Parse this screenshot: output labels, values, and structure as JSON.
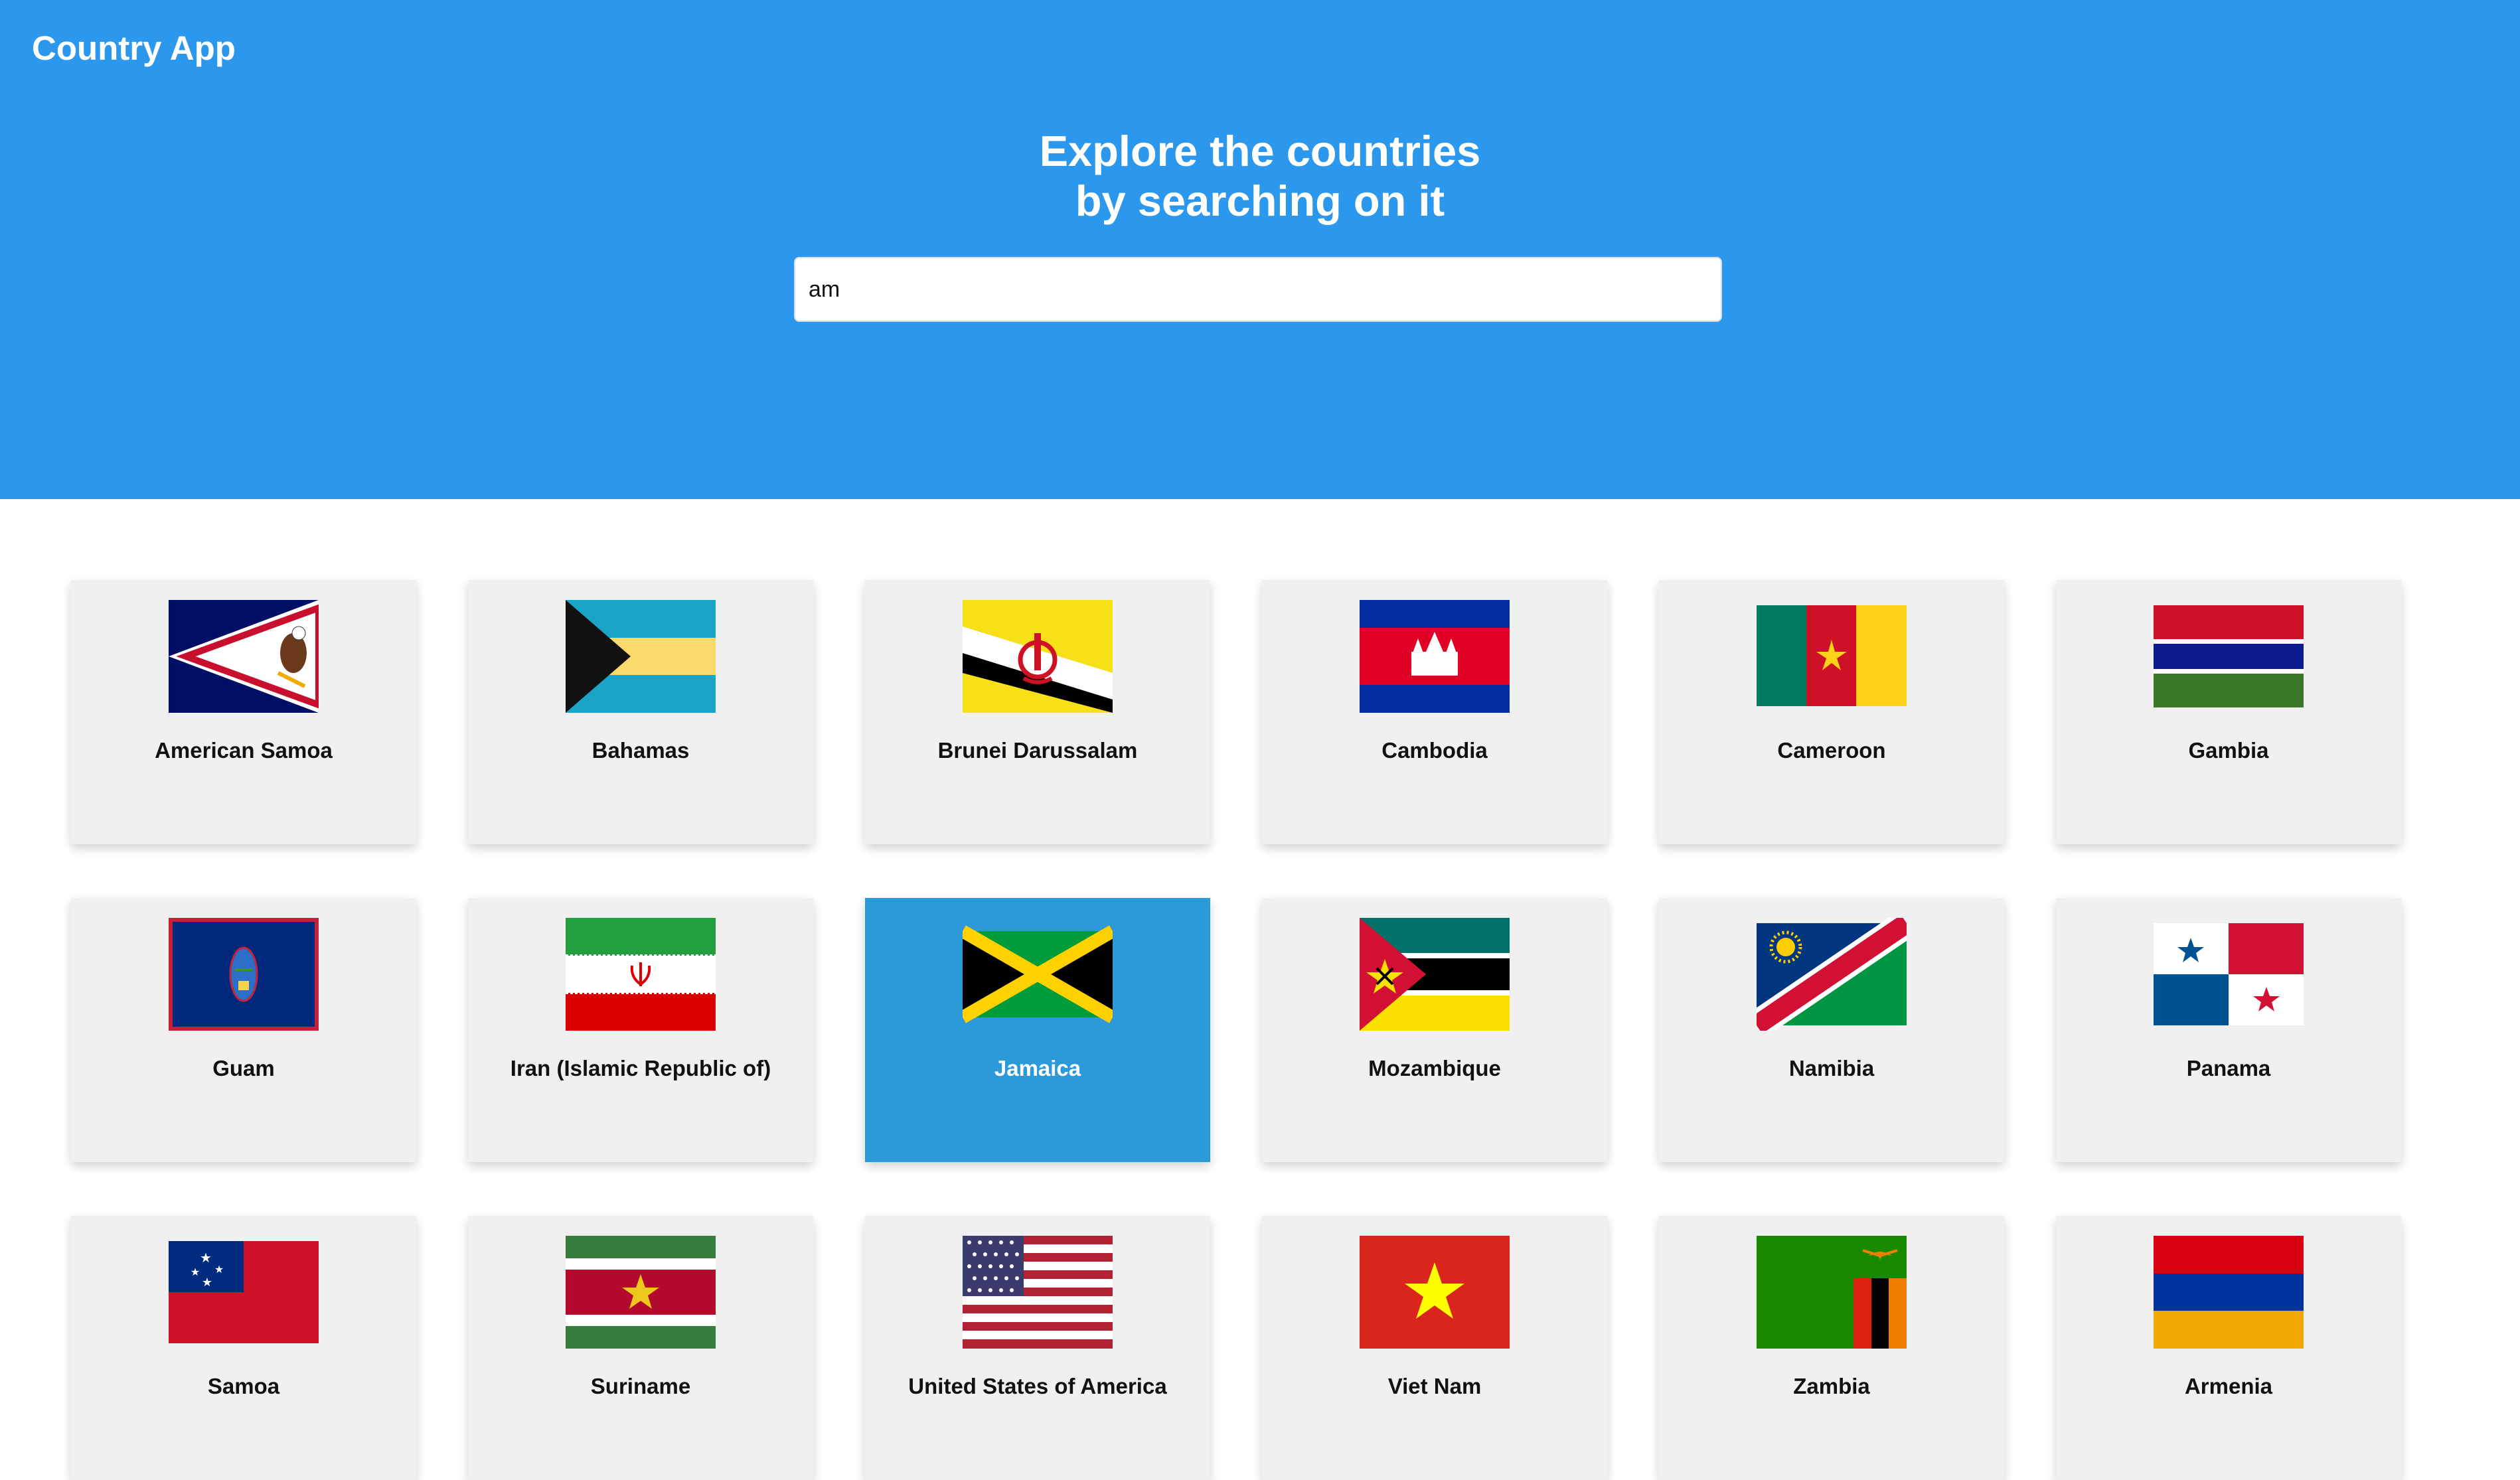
{
  "app": {
    "title": "Country App"
  },
  "hero": {
    "line1": "Explore the countries",
    "line2": "by searching on it"
  },
  "search": {
    "value": "am",
    "placeholder": ""
  },
  "colors": {
    "header": "#2b97ed",
    "card": "#f0f0f0",
    "card_active": "#2c99d9"
  },
  "countries": [
    {
      "name": "American Samoa",
      "flag": "american-samoa-flag",
      "active": false
    },
    {
      "name": "Bahamas",
      "flag": "bahamas-flag",
      "active": false
    },
    {
      "name": "Brunei Darussalam",
      "flag": "brunei-flag",
      "active": false
    },
    {
      "name": "Cambodia",
      "flag": "cambodia-flag",
      "active": false
    },
    {
      "name": "Cameroon",
      "flag": "cameroon-flag",
      "active": false
    },
    {
      "name": "Gambia",
      "flag": "gambia-flag",
      "active": false
    },
    {
      "name": "Guam",
      "flag": "guam-flag",
      "active": false
    },
    {
      "name": "Iran (Islamic Republic of)",
      "flag": "iran-flag",
      "active": false
    },
    {
      "name": "Jamaica",
      "flag": "jamaica-flag",
      "active": true
    },
    {
      "name": "Mozambique",
      "flag": "mozambique-flag",
      "active": false
    },
    {
      "name": "Namibia",
      "flag": "namibia-flag",
      "active": false
    },
    {
      "name": "Panama",
      "flag": "panama-flag",
      "active": false
    },
    {
      "name": "Samoa",
      "flag": "samoa-flag",
      "active": false
    },
    {
      "name": "Suriname",
      "flag": "suriname-flag",
      "active": false
    },
    {
      "name": "United States of America",
      "flag": "usa-flag",
      "active": false
    },
    {
      "name": "Viet Nam",
      "flag": "vietnam-flag",
      "active": false
    },
    {
      "name": "Zambia",
      "flag": "zambia-flag",
      "active": false
    },
    {
      "name": "Armenia",
      "flag": "armenia-flag",
      "active": false
    }
  ]
}
